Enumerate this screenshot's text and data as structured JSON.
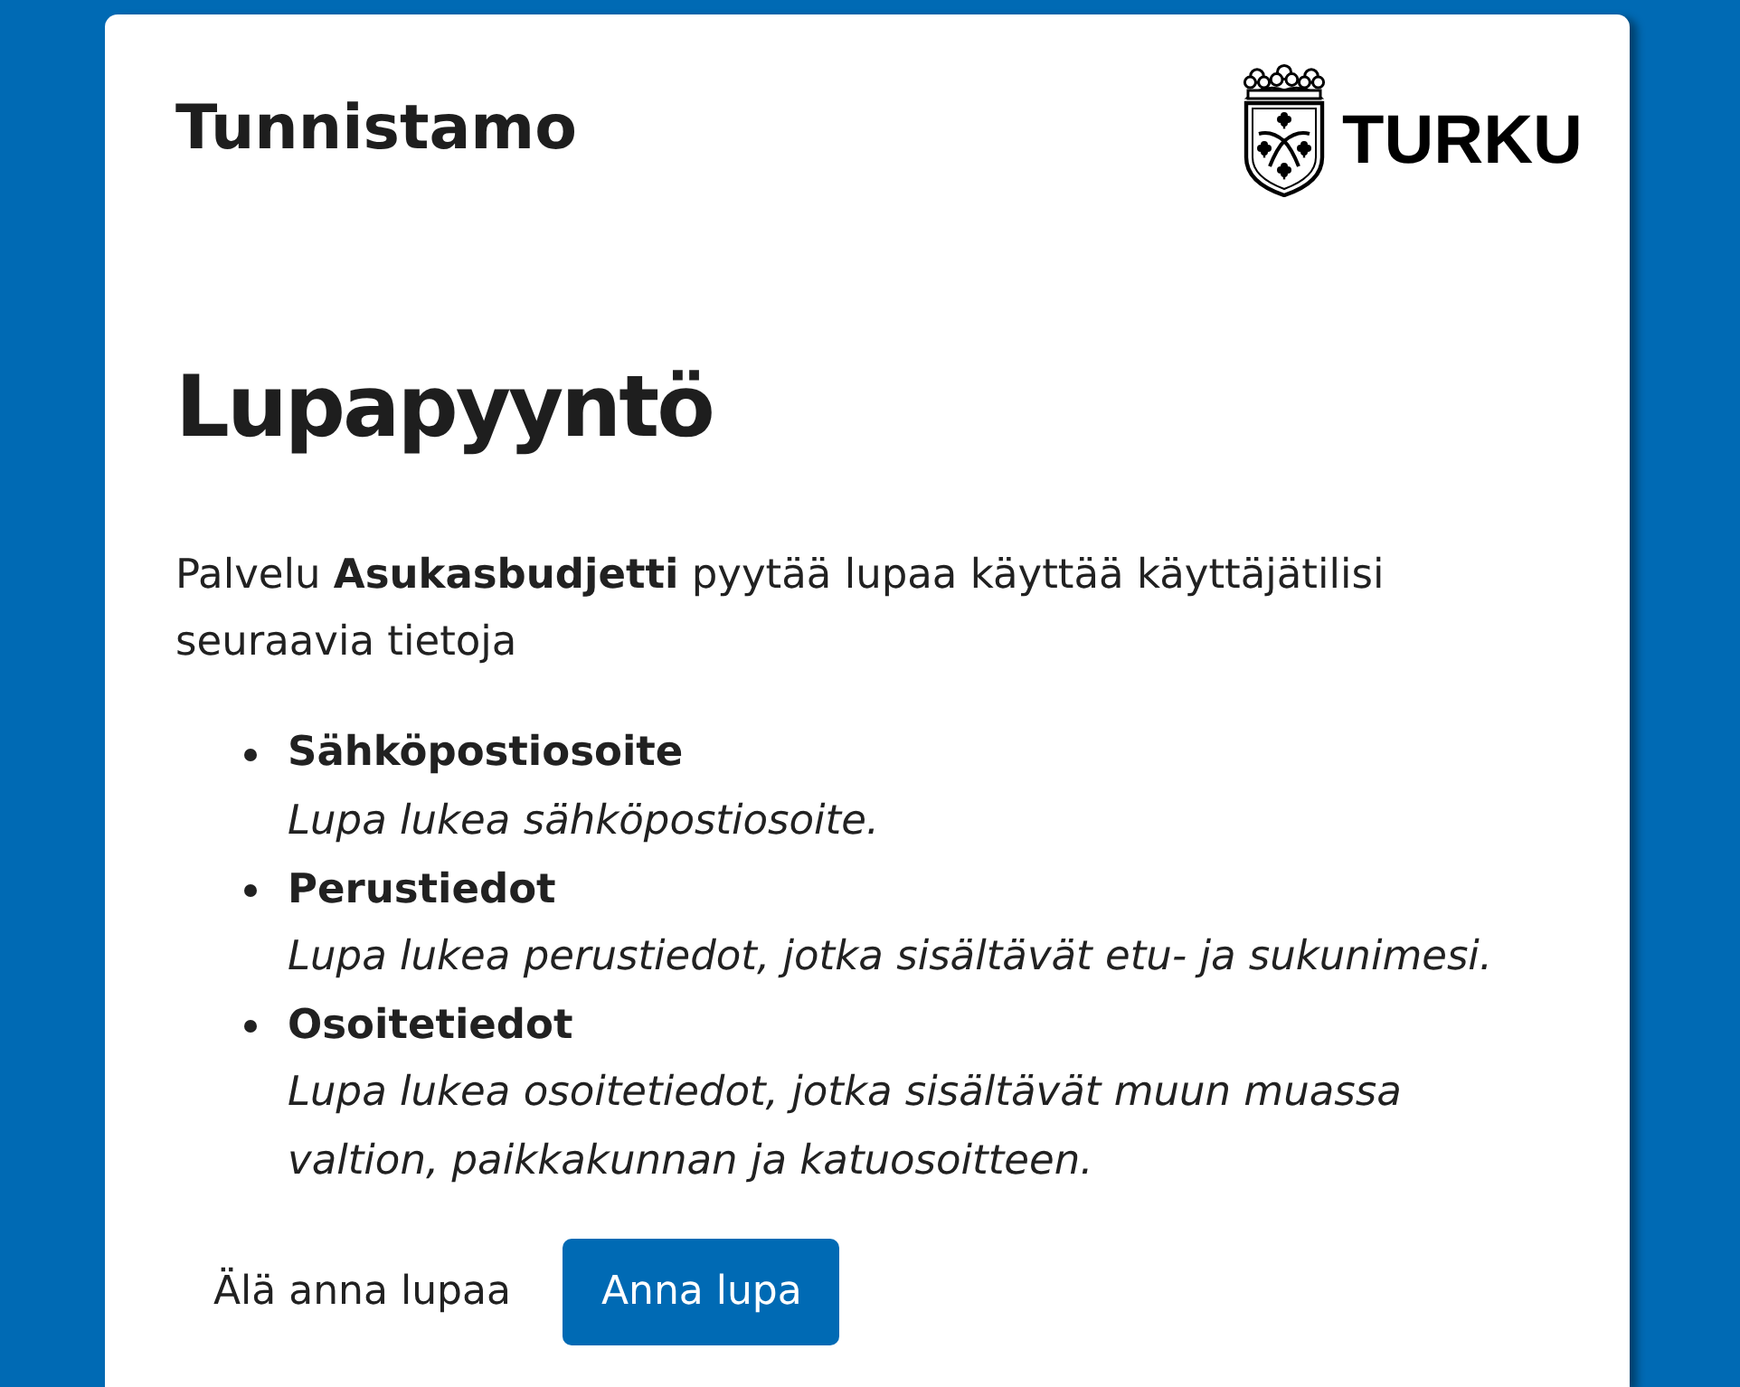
{
  "header": {
    "title": "Tunnistamo",
    "logo": {
      "text": "TURKU"
    }
  },
  "heading": "Lupapyyntö",
  "intro": "Palvelu **Asukasbudjetti** pyytää lupaa käyttää käyttäjätilisi seuraavia tietoja",
  "permissions": [
    {
      "name": "Sähköpostiosoite",
      "description": "Lupa lukea sähköpostiosoite."
    },
    {
      "name": "Perustiedot",
      "description": "Lupa lukea perustiedot, jotka sisältävät etu- ja sukunimesi."
    },
    {
      "name": "Osoitetiedot",
      "description": "Lupa lukea osoitetiedot, jotka sisältävät muun muassa valtion, paikkakunnan ja katuosoitteen."
    }
  ],
  "buttons": [
    {
      "label": "Älä anna lupaa",
      "kind": "link"
    },
    {
      "label": "Anna lupa",
      "kind": "primary"
    }
  ]
}
